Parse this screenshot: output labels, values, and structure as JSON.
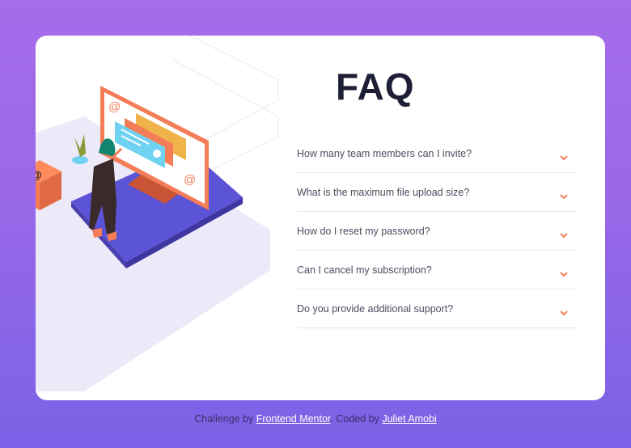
{
  "faq": {
    "title": "FAQ",
    "questions": [
      {
        "question": "How many team members can I invite?"
      },
      {
        "question": "What is the maximum file upload size?"
      },
      {
        "question": "How do I reset my password?"
      },
      {
        "question": "Can I cancel my subscription?"
      },
      {
        "question": "Do you provide additional support?"
      }
    ],
    "chevron_icon": "chevron-down-icon"
  },
  "illustration": {
    "glyph": "@"
  },
  "footer": {
    "prefix": "Challenge by",
    "challenge_link": "Frontend Mentor",
    "middle": ". Coded by",
    "author_link": "Juliet Amobi"
  },
  "colors": {
    "background_top": "#a66cea",
    "background_bottom": "#7a62e6",
    "card": "#ffffff",
    "title": "#1e1f36",
    "accent": "#f47c57"
  }
}
